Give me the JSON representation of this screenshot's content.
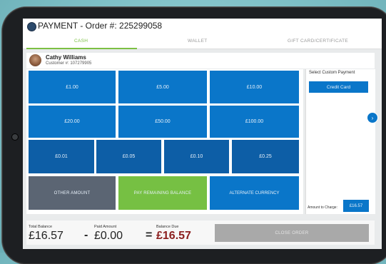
{
  "window": {
    "title": "PAYMENT - Order #: 225299058"
  },
  "tabs": [
    {
      "label": "CASH",
      "active": true
    },
    {
      "label": "WALLET",
      "active": false
    },
    {
      "label": "GIFT CARD/CERTIFICATE",
      "active": false
    }
  ],
  "customer": {
    "name": "Cathy Williams",
    "number": "Customer #: 107279905"
  },
  "amounts": {
    "row1": [
      "£1.00",
      "£5.00",
      "£10.00"
    ],
    "row2": [
      "£20.00",
      "£50.00",
      "£100.00"
    ],
    "row3": [
      "£0.01",
      "£0.05",
      "£0.10",
      "£0.25"
    ]
  },
  "actions": {
    "other_amount": "OTHER AMOUNT",
    "pay_remaining": "PAY REMAINING BALANCE",
    "alternate_currency": "ALTERNATE CURRENCY"
  },
  "custom_payment": {
    "title": "Select Custom Payment",
    "credit_card": "Credit Card",
    "amount_to_charge_label": "Amount to Charge:",
    "amount_to_charge_value": "£16.57"
  },
  "summary": {
    "total_balance_label": "Total Balance",
    "total_balance": "£16.57",
    "paid_amount_label": "Paid Amount",
    "paid_amount": "£0.00",
    "balance_due_label": "Balance Due",
    "balance_due": "£16.57",
    "minus": "-",
    "equals": "=",
    "close_order": "CLOSE ORDER"
  },
  "colors": {
    "primary_blue": "#0a76c9",
    "dark_blue": "#0d5ea6",
    "green": "#76c043",
    "grey": "#5b6573",
    "due_red": "#8b1e1e"
  },
  "icons": {
    "next": "chevron-right-icon"
  }
}
